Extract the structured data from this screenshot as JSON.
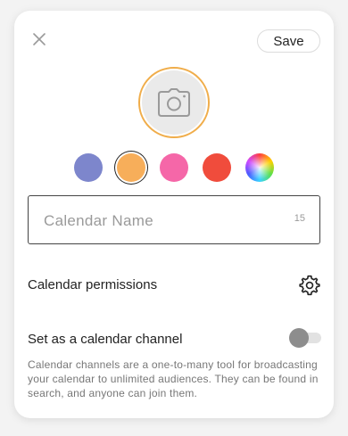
{
  "header": {
    "close_icon": "close-icon",
    "save_label": "Save"
  },
  "avatar": {
    "icon": "camera-icon",
    "ring_color": "#f0ad4a"
  },
  "colors": {
    "options": [
      {
        "name": "periwinkle",
        "hex": "#7d86cc"
      },
      {
        "name": "orange",
        "hex": "#f7ae5a",
        "selected": true
      },
      {
        "name": "pink",
        "hex": "#f567a8"
      },
      {
        "name": "red",
        "hex": "#f04c3c"
      },
      {
        "name": "custom",
        "hex": "rainbow"
      }
    ]
  },
  "name_field": {
    "placeholder": "Calendar Name",
    "value": "",
    "remaining": "15"
  },
  "permissions": {
    "label": "Calendar permissions",
    "icon": "gear-icon"
  },
  "channel": {
    "label": "Set as a calendar channel",
    "enabled": false,
    "description": "Calendar channels are a one-to-many tool for broadcasting your calendar to unlimited audiences. They can be found in search, and anyone can join them."
  }
}
